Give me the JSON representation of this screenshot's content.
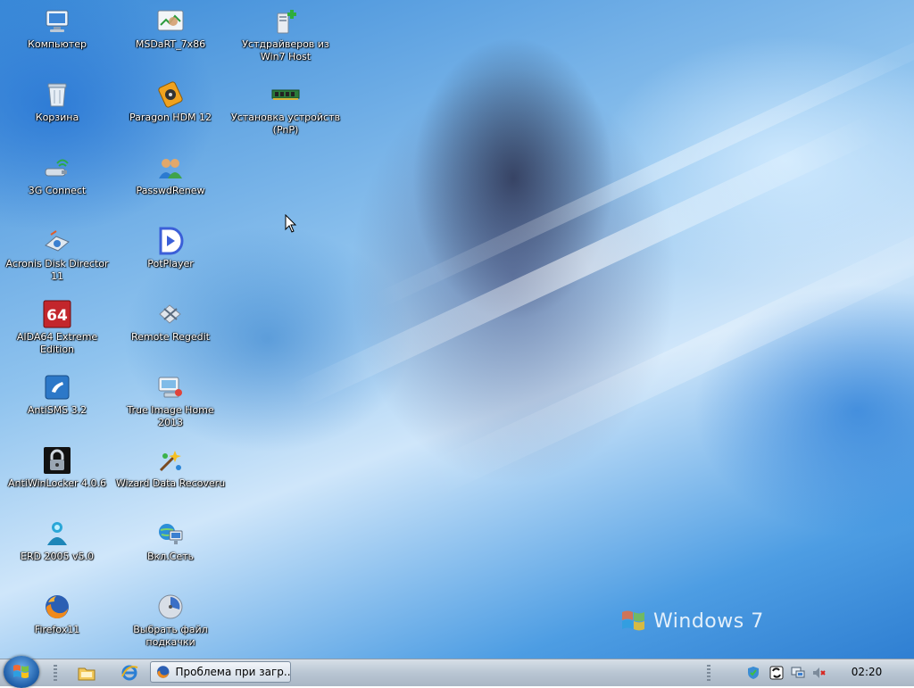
{
  "desktop": {
    "icons": [
      {
        "label": "Компьютер",
        "icon": "computer-icon"
      },
      {
        "label": "Корзина",
        "icon": "recycle-bin-icon"
      },
      {
        "label": "3G Connect",
        "icon": "modem-icon"
      },
      {
        "label": "Acronis Disk Director 11",
        "icon": "disk-director-icon"
      },
      {
        "label": "AIDA64 Extreme Edition",
        "icon": "aida64-icon"
      },
      {
        "label": "AntiSMS 3.2",
        "icon": "phone-icon"
      },
      {
        "label": "AntiWinLocker 4.0.6",
        "icon": "lock-icon"
      },
      {
        "label": "ERD 2005 v5.0",
        "icon": "person-icon"
      },
      {
        "label": "Firefox11",
        "icon": "firefox-icon"
      },
      {
        "label": "MSDaRT_7x86",
        "icon": "diagnostics-icon"
      },
      {
        "label": "Paragon HDM 12",
        "icon": "paragon-icon"
      },
      {
        "label": "PasswdRenew",
        "icon": "users-icon"
      },
      {
        "label": "PotPlayer",
        "icon": "potplayer-icon"
      },
      {
        "label": "Remote Regedit",
        "icon": "regedit-icon"
      },
      {
        "label": "True Image Home 2013",
        "icon": "true-image-icon"
      },
      {
        "label": "Wizard Data Recoveru",
        "icon": "wizard-icon"
      },
      {
        "label": "Вкл.Сеть",
        "icon": "network-icon"
      },
      {
        "label": "Выбрать файл подкачки",
        "icon": "pagefile-icon"
      },
      {
        "label": "Устдрайверов из Win7 Host",
        "icon": "driver-install-icon"
      },
      {
        "label": "Установка устройств (PnP)",
        "icon": "memory-module-icon"
      }
    ],
    "watermark_text": "Windows 7",
    "accent": "#3a8ad8"
  },
  "taskbar": {
    "start_icon": "windows-logo-icon",
    "quick_launch": [
      {
        "name": "explorer-icon"
      },
      {
        "name": "internet-explorer-icon"
      }
    ],
    "active_task": {
      "label": "Проблема при загр...",
      "icon": "firefox-icon"
    },
    "tray": [
      "security-icon",
      "sync-icon",
      "network-status-icon",
      "volume-muted-icon"
    ],
    "clock": "02:20"
  }
}
